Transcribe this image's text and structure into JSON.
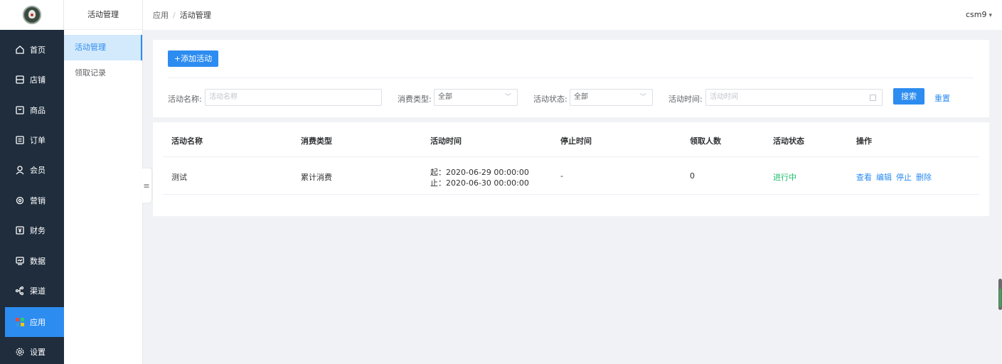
{
  "sidebar": {
    "items": [
      {
        "label": "首页",
        "icon": "home-icon"
      },
      {
        "label": "店铺",
        "icon": "store-icon"
      },
      {
        "label": "商品",
        "icon": "bag-icon"
      },
      {
        "label": "订单",
        "icon": "order-icon"
      },
      {
        "label": "会员",
        "icon": "user-icon"
      },
      {
        "label": "营销",
        "icon": "gear-icon"
      },
      {
        "label": "财务",
        "icon": "yen-icon"
      },
      {
        "label": "数据",
        "icon": "chart-icon"
      },
      {
        "label": "渠道",
        "icon": "channel-icon"
      },
      {
        "label": "应用",
        "icon": "apps-icon"
      },
      {
        "label": "设置",
        "icon": "settings-icon"
      }
    ],
    "active_index": 9,
    "active_color": "#2d8cf0"
  },
  "subside": {
    "title": "活动管理",
    "items": [
      {
        "label": "活动管理"
      },
      {
        "label": "领取记录"
      }
    ]
  },
  "header": {
    "breadcrumb_root": "应用",
    "breadcrumb_sep": "/",
    "breadcrumb_current": "活动管理",
    "user": "csm9"
  },
  "toolbar": {
    "add_label": "+添加活动"
  },
  "filters": {
    "name_label": "活动名称:",
    "name_placeholder": "活动名称",
    "type_label": "消费类型:",
    "type_value": "全部",
    "status_label": "活动状态:",
    "status_value": "全部",
    "time_label": "活动时间:",
    "time_placeholder": "活动时间",
    "search_label": "搜索",
    "reset_label": "重置"
  },
  "table": {
    "headers": [
      "活动名称",
      "消费类型",
      "活动时间",
      "停止时间",
      "领取人数",
      "活动状态",
      "操作"
    ],
    "rows": [
      {
        "name": "测试",
        "type": "累计消费",
        "start": "起：2020-06-29 00:00:00",
        "end": "止：2020-06-30 00:00:00",
        "stop": "-",
        "count": "0",
        "status": "进行中",
        "ops": [
          "查看",
          "编辑",
          "停止",
          "删除"
        ]
      }
    ]
  }
}
